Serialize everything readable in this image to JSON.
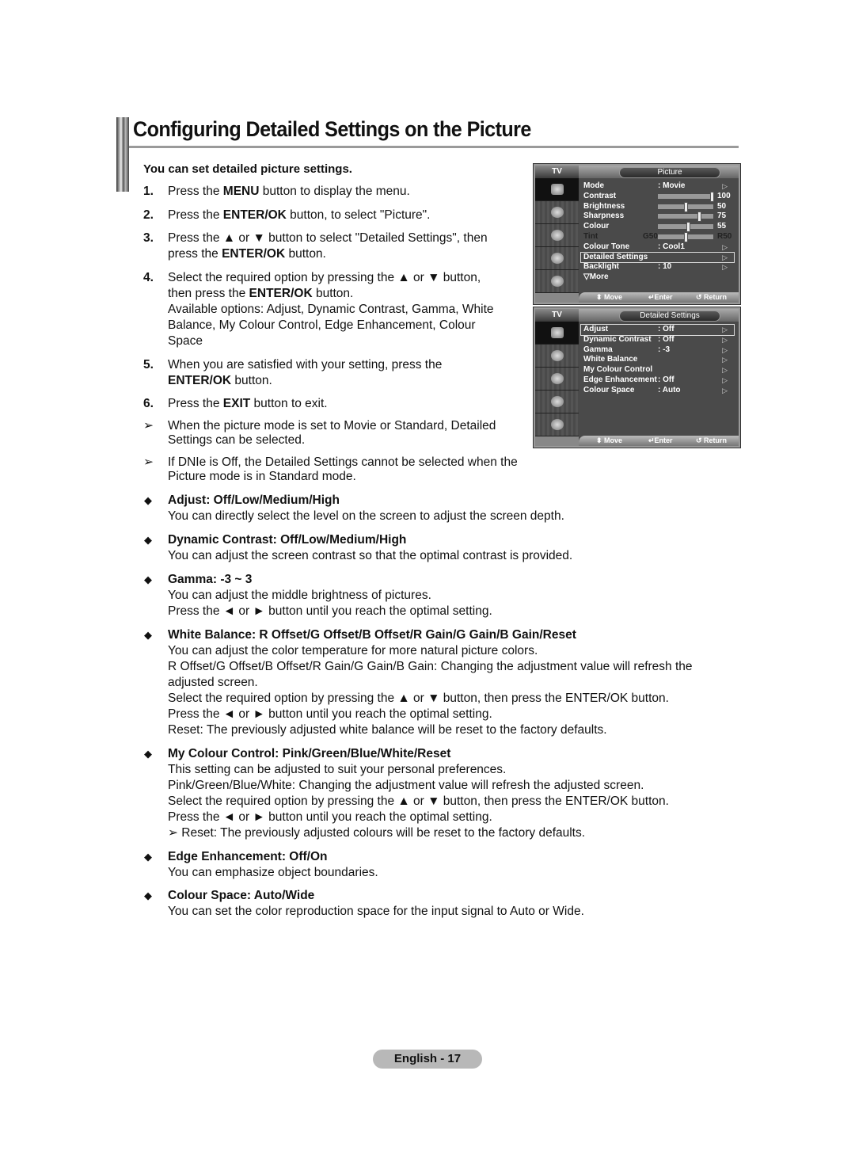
{
  "page": {
    "title": "Configuring Detailed Settings on the Picture",
    "intro": "You can set detailed picture settings.",
    "steps": [
      {
        "num": "1.",
        "pre": "Press the ",
        "bold": "MENU",
        "post": " button to display the menu."
      },
      {
        "num": "2.",
        "pre": "Press the ",
        "bold": "ENTER/OK",
        "post": " button, to select \"Picture\"."
      },
      {
        "num": "3.",
        "line1": "Press the ▲ or ▼ button to select \"Detailed Settings\", then",
        "pre": "press the ",
        "bold": "ENTER/OK",
        "post": " button."
      },
      {
        "num": "4.",
        "line1": "Select the required option by pressing the ▲ or ▼ button,",
        "pre": "then press the ",
        "bold": "ENTER/OK",
        "post": " button.",
        "extra": "Available options:  Adjust, Dynamic Contrast, Gamma, White Balance, My Colour Control, Edge Enhancement, Colour Space"
      },
      {
        "num": "5.",
        "line1": "When you are satisfied with your setting, press the",
        "bold": "ENTER/OK",
        "post": " button."
      },
      {
        "num": "6.",
        "pre": "Press the ",
        "bold": "EXIT",
        "post": " button to exit."
      }
    ],
    "notes": [
      "When the picture mode is set to Movie or Standard, Detailed Settings can be selected.",
      "If DNIe is Off, the Detailed Settings cannot be selected when the Picture mode is in Standard mode."
    ],
    "note_arrow": "➢",
    "bullet": "◆",
    "options": [
      {
        "head": "Adjust: Off/Low/Medium/High",
        "lines": [
          "You can directly select the  level on the screen to adjust the screen depth."
        ]
      },
      {
        "head": "Dynamic Contrast: Off/Low/Medium/High",
        "lines": [
          "You can adjust the screen contrast so that the optimal contrast is provided."
        ]
      },
      {
        "head": "Gamma: -3 ~ 3",
        "lines": [
          "You can adjust the middle brightness of pictures.",
          "Press the ◄ or ► button until you reach the optimal setting."
        ]
      },
      {
        "head": "White Balance: R Offset/G Offset/B Offset/R Gain/G Gain/B Gain/Reset",
        "lines": [
          "You can adjust the color temperature for more natural picture colors.",
          "R Offset/G Offset/B Offset/R Gain/G Gain/B Gain: Changing the adjustment value will refresh the adjusted screen.",
          "Select the required option by pressing the ▲ or ▼ button, then press the ENTER/OK button.",
          "Press the ◄ or ► button until you reach the optimal setting.",
          "Reset: The previously adjusted white balance will be reset to the factory defaults."
        ]
      },
      {
        "head": "My Colour Control: Pink/Green/Blue/White/Reset",
        "lines": [
          "This setting can be adjusted to suit your personal preferences.",
          "Pink/Green/Blue/White: Changing the adjustment value will refresh the adjusted screen.",
          "Select the required option by pressing the ▲ or ▼ button, then press the ENTER/OK button.",
          "Press the ◄ or ► button until you reach the optimal setting.",
          "➢ Reset: The previously adjusted colours will be reset to the factory defaults."
        ]
      },
      {
        "head": "Edge Enhancement: Off/On",
        "lines": [
          "You can emphasize object boundaries."
        ]
      },
      {
        "head": "Colour Space: Auto/Wide",
        "lines": [
          "You can set the color reproduction space for the input signal to Auto or Wide."
        ]
      }
    ],
    "footer": "English - 17"
  },
  "osd_picture": {
    "tv_label": "TV",
    "title": "Picture",
    "rows": [
      {
        "label": "Mode",
        "value": ": Movie",
        "arrow": true
      },
      {
        "label": "Contrast",
        "slider": 100,
        "number": "100"
      },
      {
        "label": "Brightness",
        "slider": 50,
        "number": "50"
      },
      {
        "label": "Sharpness",
        "slider": 75,
        "number": "75"
      },
      {
        "label": "Colour",
        "slider": 55,
        "number": "55"
      },
      {
        "label": "Tint",
        "left": "G50",
        "right": "R50",
        "slider": 50,
        "dim": true
      },
      {
        "label": "Colour Tone",
        "value": ": Cool1",
        "arrow": true
      },
      {
        "label": "Detailed Settings",
        "arrow": true,
        "selected": true
      },
      {
        "label": "Backlight",
        "value": ": 10",
        "arrow": true
      },
      {
        "label": "▽More"
      }
    ],
    "footer": {
      "move": "⬍ Move",
      "enter": "↵Enter",
      "return": "↺ Return"
    }
  },
  "osd_detailed": {
    "tv_label": "TV",
    "title": "Detailed Settings",
    "rows": [
      {
        "label": " Adjust",
        "value": ": Off",
        "arrow": true,
        "selected": true
      },
      {
        "label": "Dynamic Contrast",
        "value": ": Off",
        "arrow": true
      },
      {
        "label": "Gamma",
        "value": ": -3",
        "arrow": true
      },
      {
        "label": "White Balance",
        "arrow": true
      },
      {
        "label": "My Colour Control",
        "arrow": true
      },
      {
        "label": "Edge Enhancement",
        "value": ": Off",
        "arrow": true
      },
      {
        "label": "Colour Space",
        "value": ": Auto",
        "arrow": true
      }
    ],
    "footer": {
      "move": "⬍ Move",
      "enter": "↵Enter",
      "return": "↺ Return"
    }
  }
}
